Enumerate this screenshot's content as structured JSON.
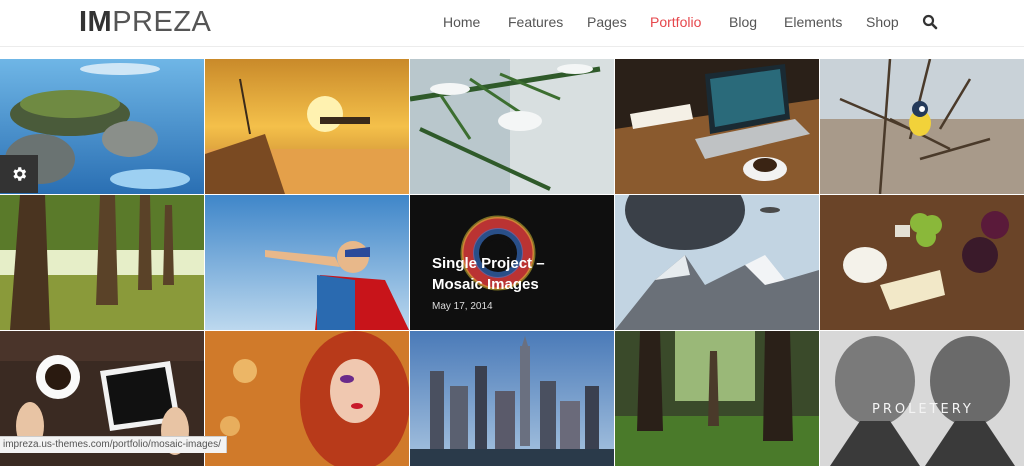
{
  "header": {
    "logo_bold": "IM",
    "logo_rest": "PREZA",
    "nav": [
      {
        "label": "Home",
        "active": false
      },
      {
        "label": "Features",
        "active": false
      },
      {
        "label": "Pages",
        "active": false
      },
      {
        "label": "Portfolio",
        "active": true
      },
      {
        "label": "Blog",
        "active": false
      },
      {
        "label": "Elements",
        "active": false
      },
      {
        "label": "Shop",
        "active": false
      }
    ],
    "search_icon": "search-icon",
    "accent_color": "#e6474c"
  },
  "portfolio": {
    "featured": {
      "title": "Single Project – Mosaic Images",
      "date": "May 17, 2014"
    },
    "tiles": [
      {
        "name": "tile-turtle-island"
      },
      {
        "name": "tile-sunset-airship"
      },
      {
        "name": "tile-snowy-branch"
      },
      {
        "name": "tile-laptop-desk"
      },
      {
        "name": "tile-bird-branch"
      },
      {
        "name": "tile-forest-trees"
      },
      {
        "name": "tile-superhero-child"
      },
      {
        "name": "tile-featured-project"
      },
      {
        "name": "tile-floating-mountain"
      },
      {
        "name": "tile-food-platter"
      },
      {
        "name": "tile-coffee-tablet"
      },
      {
        "name": "tile-portrait-woman"
      },
      {
        "name": "tile-city-skyline"
      },
      {
        "name": "tile-green-forest"
      },
      {
        "name": "tile-proletery-lions"
      }
    ]
  },
  "settings_icon": "gear-icon",
  "status_bar": {
    "url": "impreza.us-themes.com/portfolio/mosaic-images/"
  }
}
